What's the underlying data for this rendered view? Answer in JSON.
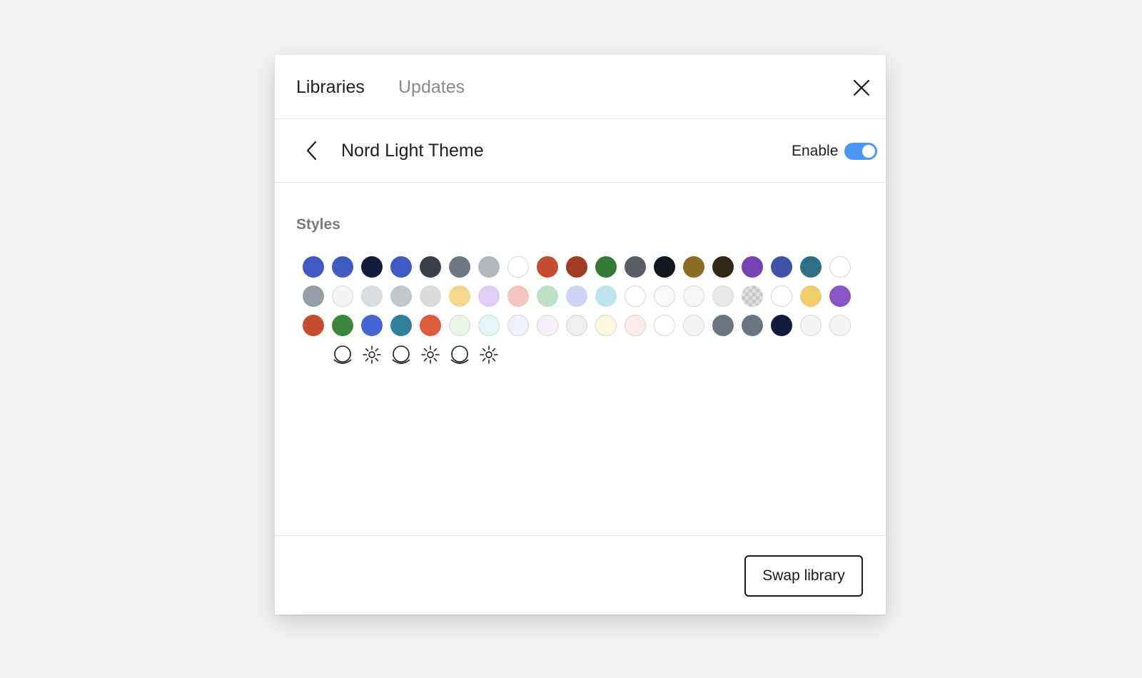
{
  "tabs": [
    {
      "label": "Libraries",
      "active": true
    },
    {
      "label": "Updates",
      "active": false
    }
  ],
  "library": {
    "title": "Nord Light Theme",
    "enable_label": "Enable",
    "enabled": true
  },
  "styles": {
    "heading": "Styles",
    "swatch_rows": [
      [
        "#3f5ac2",
        "#3f5ac2",
        "#111c3f",
        "#3f5ac2",
        "#3b4048",
        "#6d7883",
        "#b3b8be",
        "#ffffff",
        "#c64c2f",
        "#a33c24",
        "#357a34",
        "#5a5d63",
        "#11171d",
        "#8d6c24",
        "#2f2814",
        "#7443b1",
        "#3f52a8",
        "#2e6e86",
        "#ffffff"
      ],
      [
        "#939ea8",
        "#f4f4f5",
        "#dadde1",
        "#c3c7cc",
        "#dadbdd",
        "#f3d78a",
        "#decdf4",
        "#f3c7c0",
        "#bee0c4",
        "#ccd5f6",
        "#bde4ed",
        "#ffffff",
        "#f7f8f9",
        "#f7f7f8",
        "#e7e8ea",
        "checker",
        "#ffffff",
        "#efcf6b",
        "#8a55c4"
      ],
      [
        "#c64c2f",
        "#3e873c",
        "#4565d6",
        "#33809c",
        "#dd5e3e",
        "#eaf5e6",
        "#e6f5f8",
        "#eff1fc",
        "#f7effc",
        "#eff0f1",
        "#fdf8df",
        "#fbeceb",
        "#ffffff",
        "#f4f4f4",
        "#6b7580",
        "#6b7580",
        "#111c3f",
        "#f4f4f4",
        "#f4f4f4"
      ]
    ],
    "effects": [
      "shadow-effect-icon",
      "sun-effect-icon",
      "shadow-effect-icon",
      "sun-effect-icon",
      "shadow-effect-icon",
      "sun-effect-icon"
    ]
  },
  "footer": {
    "swap_label": "Swap library"
  },
  "colors": {
    "toggle_on": "#4a96f2",
    "background": "#f4f4f4",
    "panel": "#ffffff"
  }
}
